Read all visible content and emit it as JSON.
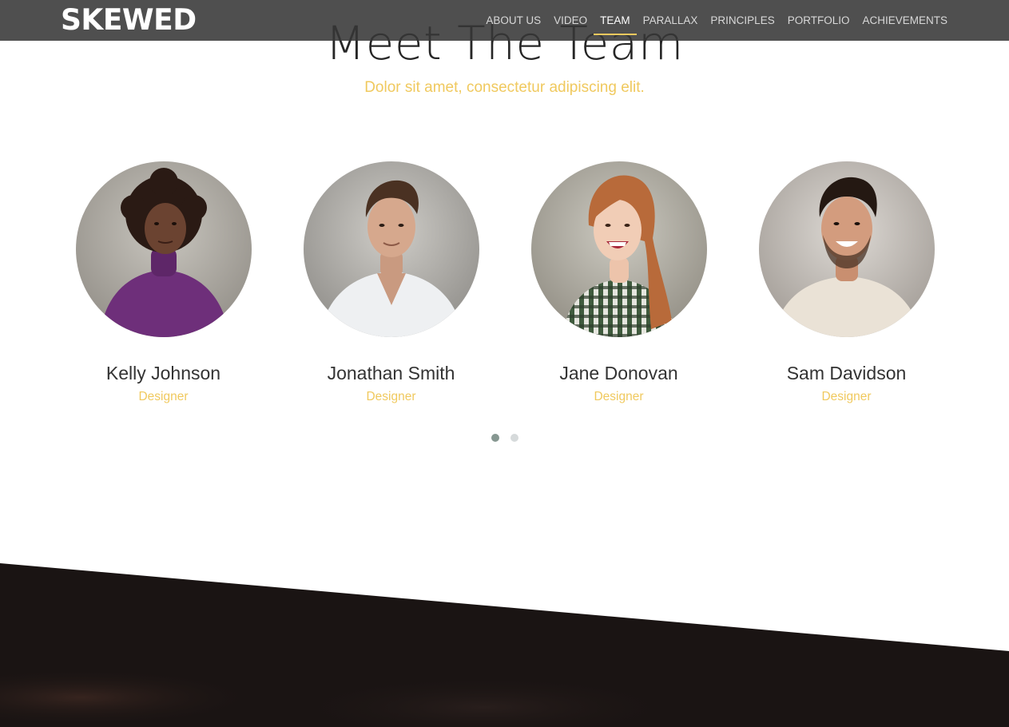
{
  "navbar": {
    "brand": "SKEWED",
    "items": [
      {
        "label": "ABOUT US",
        "active": false
      },
      {
        "label": "VIDEO",
        "active": false
      },
      {
        "label": "TEAM",
        "active": true
      },
      {
        "label": "PARALLAX",
        "active": false
      },
      {
        "label": "PRINCIPLES",
        "active": false
      },
      {
        "label": "PORTFOLIO",
        "active": false
      },
      {
        "label": "ACHIEVEMENTS",
        "active": false
      }
    ]
  },
  "team_section": {
    "title": "Meet The Team",
    "subtitle": "Dolor sit amet, consectetur adipiscing elit.",
    "members": [
      {
        "name": "Kelly Johnson",
        "role": "Designer"
      },
      {
        "name": "Jonathan Smith",
        "role": "Designer"
      },
      {
        "name": "Jane Donovan",
        "role": "Designer"
      },
      {
        "name": "Sam Davidson",
        "role": "Designer"
      }
    ],
    "carousel": {
      "pages": 2,
      "current": 1
    }
  },
  "colors": {
    "accent": "#f0c95e",
    "navbar_bg": "#373737",
    "dark_section": "#1a1413",
    "dot_active": "#869791",
    "dot_inactive": "#d6dadb"
  }
}
